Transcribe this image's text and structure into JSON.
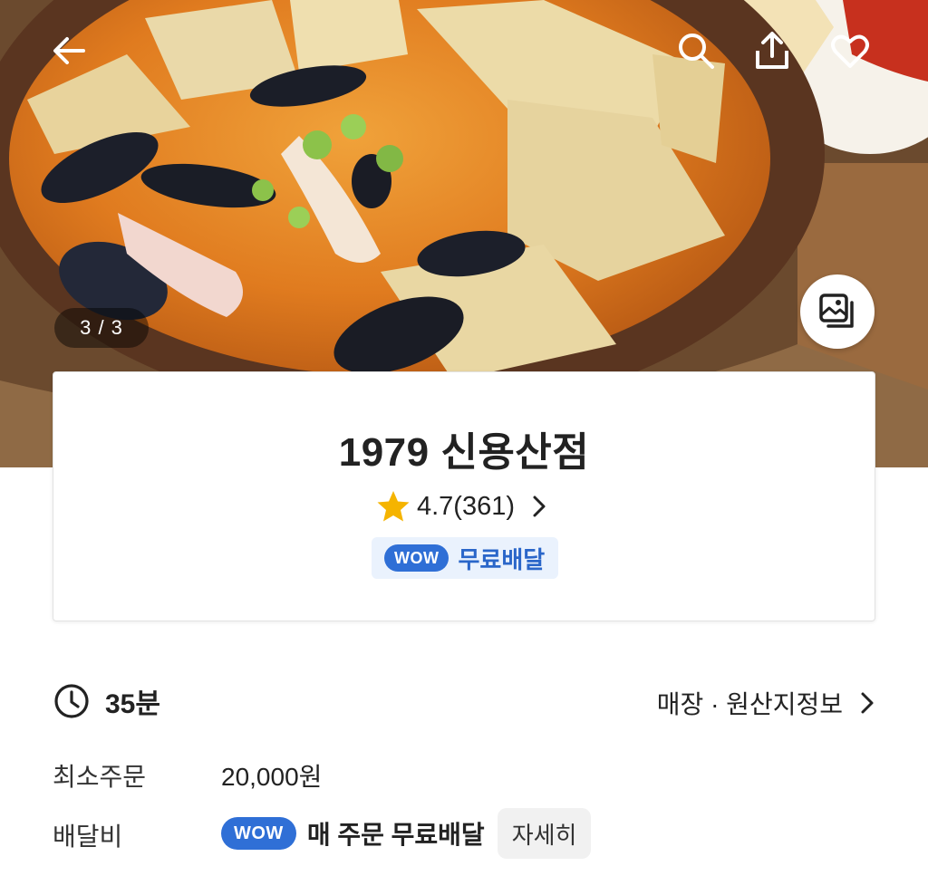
{
  "hero": {
    "image_description_icon": "food-photo",
    "counter": "3 / 3"
  },
  "topbar": {
    "back_icon": "arrow-left-icon",
    "search_icon": "search-icon",
    "share_icon": "share-icon",
    "favorite_icon": "heart-icon"
  },
  "store": {
    "name": "1979 신용산점",
    "rating": "4.7(361)",
    "badge_wow": "WOW",
    "badge_text": "무료배달"
  },
  "info": {
    "delivery_time": "35분",
    "origin_link": "매장 · 원산지정보",
    "min_order_label": "최소주문",
    "min_order_value": "20,000원",
    "delivery_fee_label": "배달비",
    "delivery_wow": "WOW",
    "delivery_fee_text": "매 주문 무료배달",
    "detail_button": "자세히"
  },
  "colors": {
    "accent_blue": "#2f6fd6",
    "badge_bg": "#eaf2fd",
    "star": "#f5b400"
  }
}
